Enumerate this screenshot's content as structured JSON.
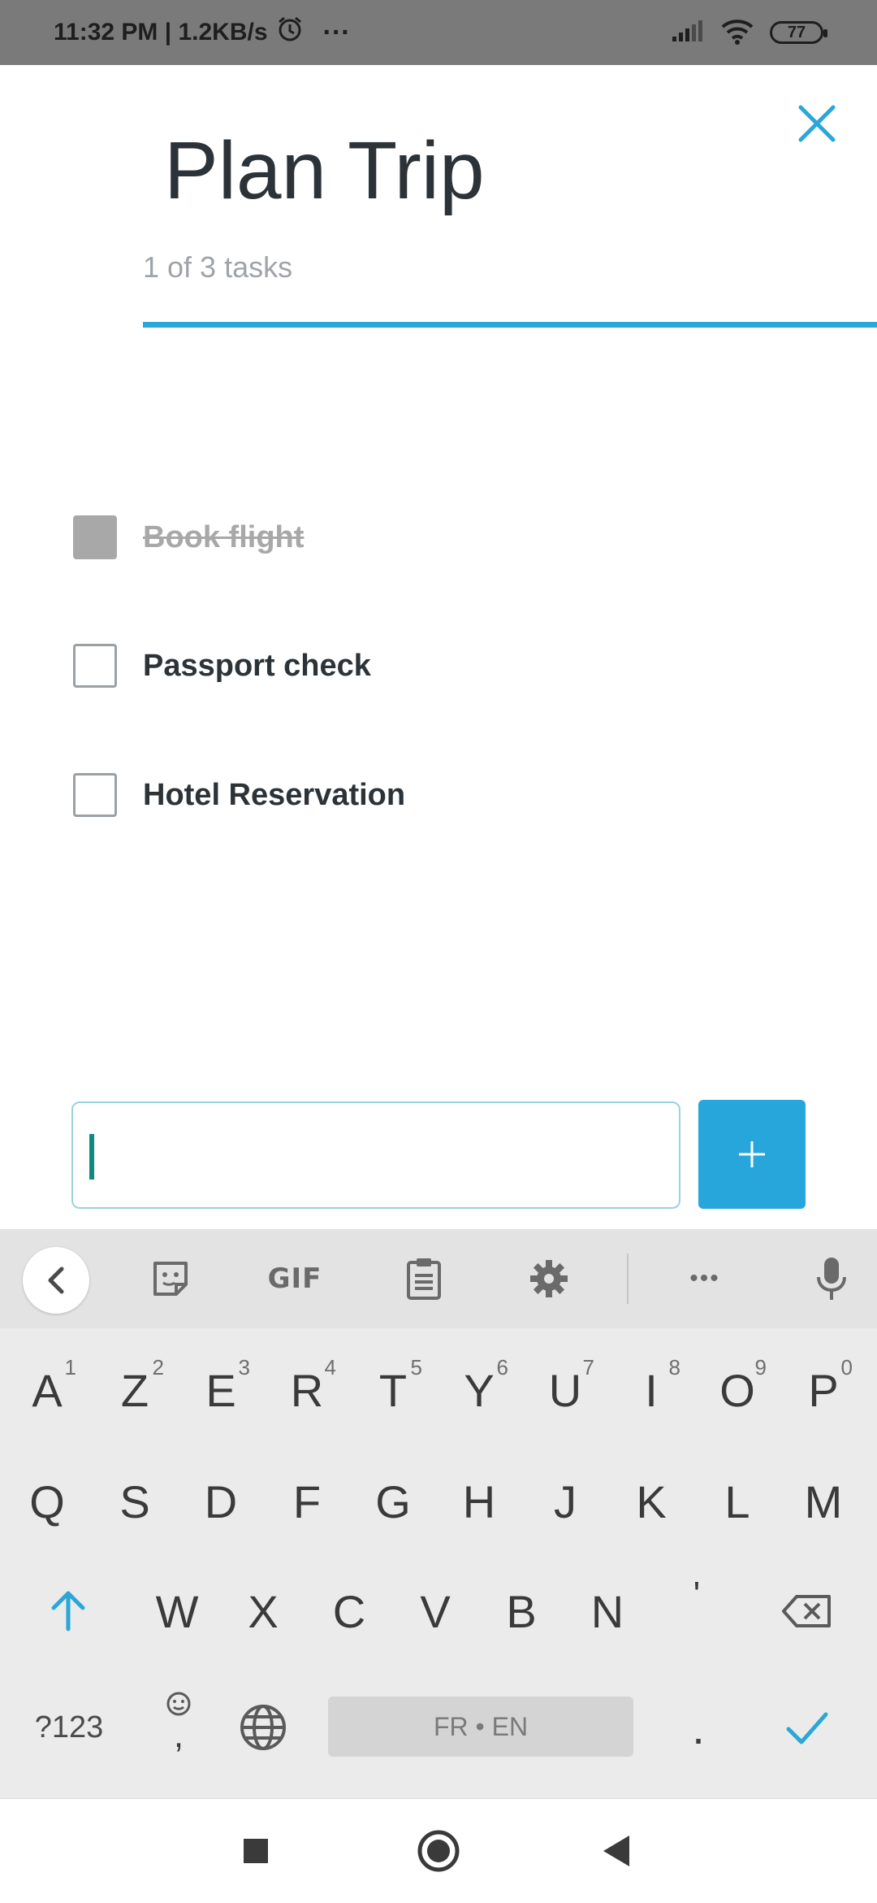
{
  "status_bar": {
    "time_speed": "11:32 PM | 1.2KB/s",
    "more": "···",
    "battery": "77"
  },
  "header": {
    "title": "Plan Trip",
    "subtitle": "1 of 3 tasks",
    "progress_fraction": 0.333,
    "accent_color": "#2aa7d8"
  },
  "tasks": [
    {
      "label": "Book flight",
      "done": true
    },
    {
      "label": "Passport check",
      "done": false
    },
    {
      "label": "Hotel Reservation",
      "done": false
    }
  ],
  "input": {
    "value": "",
    "placeholder": ""
  },
  "add_button": {
    "label": "+"
  },
  "keyboard": {
    "toolbar": {
      "gif": "GIF",
      "more": "•••"
    },
    "row1": [
      {
        "key": "A",
        "hint": "1"
      },
      {
        "key": "Z",
        "hint": "2"
      },
      {
        "key": "E",
        "hint": "3"
      },
      {
        "key": "R",
        "hint": "4"
      },
      {
        "key": "T",
        "hint": "5"
      },
      {
        "key": "Y",
        "hint": "6"
      },
      {
        "key": "U",
        "hint": "7"
      },
      {
        "key": "I",
        "hint": "8"
      },
      {
        "key": "O",
        "hint": "9"
      },
      {
        "key": "P",
        "hint": "0"
      }
    ],
    "row2": [
      "Q",
      "S",
      "D",
      "F",
      "G",
      "H",
      "J",
      "K",
      "L",
      "M"
    ],
    "row3": [
      "W",
      "X",
      "C",
      "V",
      "B",
      "N",
      "'"
    ],
    "symbols_label": "?123",
    "comma": ",",
    "space_label": "FR • EN",
    "period": "."
  }
}
